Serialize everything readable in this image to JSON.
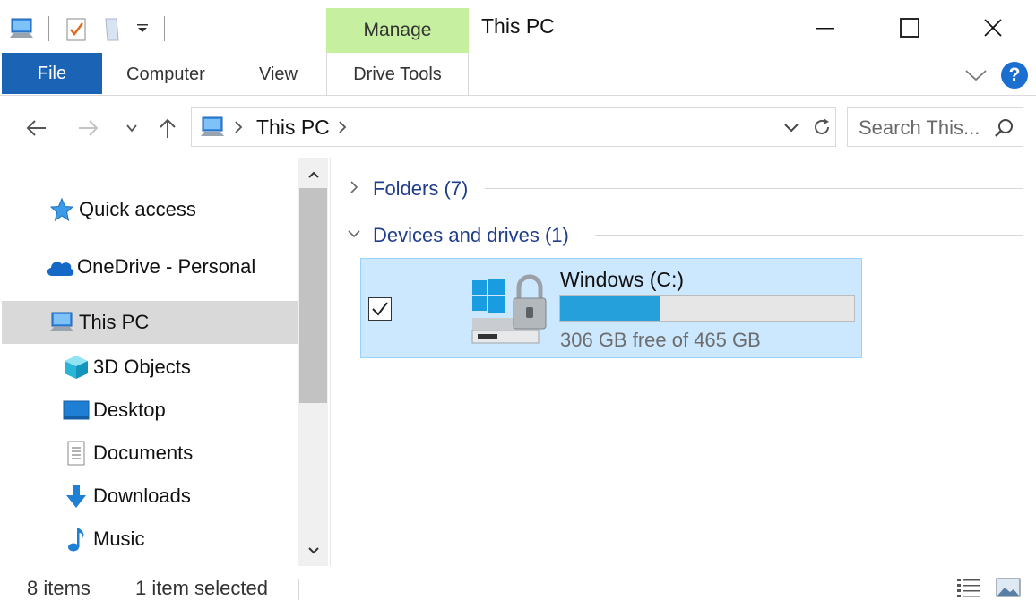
{
  "window": {
    "title": "This PC",
    "context_tab": "Manage"
  },
  "ribbon": {
    "tabs": [
      {
        "label": "File"
      },
      {
        "label": "Computer"
      },
      {
        "label": "View"
      },
      {
        "label": "Drive Tools"
      }
    ],
    "help_label": "?"
  },
  "address": {
    "location": "This PC",
    "search_placeholder": "Search This..."
  },
  "nav_pane": {
    "items": [
      {
        "label": "Quick access",
        "icon": "star-icon"
      },
      {
        "label": "OneDrive - Personal",
        "icon": "cloud-icon"
      },
      {
        "label": "This PC",
        "icon": "computer-icon",
        "selected": true
      },
      {
        "label": "3D Objects",
        "icon": "cube-icon"
      },
      {
        "label": "Desktop",
        "icon": "desktop-icon"
      },
      {
        "label": "Documents",
        "icon": "document-icon"
      },
      {
        "label": "Downloads",
        "icon": "download-arrow-icon"
      },
      {
        "label": "Music",
        "icon": "music-note-icon"
      }
    ]
  },
  "content": {
    "groups": [
      {
        "label": "Folders (7)",
        "expanded": false
      },
      {
        "label": "Devices and drives (1)",
        "expanded": true
      }
    ],
    "drive": {
      "name": "Windows (C:)",
      "free_text": "306 GB free of 465 GB",
      "used_fraction": 0.342,
      "checked": true
    }
  },
  "status": {
    "item_count": "8 items",
    "selection": "1 item selected"
  },
  "colors": {
    "file_tab": "#1a63b5",
    "manage_tab": "#c6ef9f",
    "selection": "#cce8ff",
    "progress": "#26a0da",
    "group_text": "#1f3d8c"
  }
}
